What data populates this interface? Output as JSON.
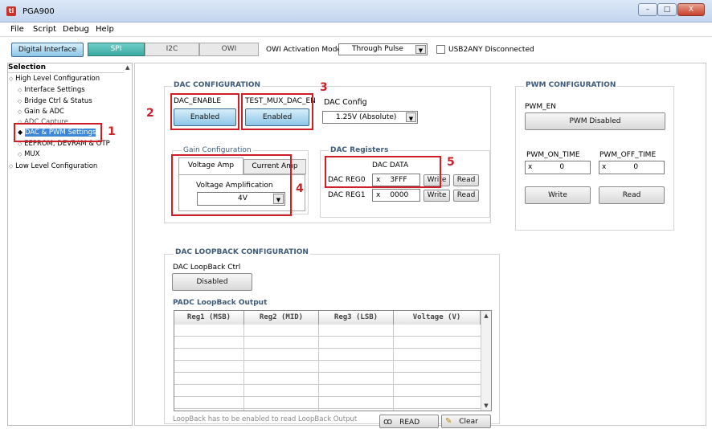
{
  "window": {
    "title": "PGA900",
    "app_icon": "ti-logo-icon",
    "controls": {
      "minimize": "–",
      "maximize": "□",
      "close": "X"
    }
  },
  "menu": [
    "File",
    "Script",
    "Debug",
    "Help"
  ],
  "toolbar": {
    "digital_interface": "Digital Interface",
    "tabs": [
      "SPI",
      "I2C",
      "OWI"
    ],
    "selected_tab": "SPI",
    "owi_mode_label": "OWI Activation Mode",
    "owi_mode_value": "Through Pulse",
    "usb_label": "USB2ANY Disconnected"
  },
  "sidebar": {
    "header": "Selection",
    "items": [
      {
        "label": "High Level Configuration",
        "level": 0
      },
      {
        "label": "Interface Settings",
        "level": 1
      },
      {
        "label": "Bridge Ctrl & Status",
        "level": 1
      },
      {
        "label": "Gain & ADC",
        "level": 1
      },
      {
        "label": "ADC Capture",
        "level": 1
      },
      {
        "label": "DAC & PWM Settings",
        "level": 1,
        "selected": true
      },
      {
        "label": "EEPROM, DEVRAM & OTP",
        "level": 1
      },
      {
        "label": "MUX",
        "level": 1
      },
      {
        "label": "Low Level Configuration",
        "level": 0
      }
    ]
  },
  "dac_config": {
    "title": "DAC CONFIGURATION",
    "dac_enable_label": "DAC_ENABLE",
    "dac_enable_btn": "Enabled",
    "test_mux_label": "TEST_MUX_DAC_EN",
    "test_mux_btn": "Enabled",
    "dac_config_label": "DAC Config",
    "dac_config_value": "1.25V (Absolute)"
  },
  "gain": {
    "title": "Gain Configuration",
    "tabs": [
      "Voltage Amp",
      "Current Amp"
    ],
    "amp_label": "Voltage Amplification",
    "amp_value": "4V"
  },
  "dac_registers": {
    "title": "DAC Registers",
    "data_label": "DAC DATA",
    "rows": [
      {
        "label": "DAC REG0",
        "prefix": "x",
        "value": "3FFF",
        "write": "Write",
        "read": "Read"
      },
      {
        "label": "DAC REG1",
        "prefix": "x",
        "value": "0000",
        "write": "Write",
        "read": "Read"
      }
    ]
  },
  "pwm": {
    "title": "PWM CONFIGURATION",
    "en_label": "PWM_EN",
    "en_btn": "PWM Disabled",
    "on_label": "PWM_ON_TIME",
    "on_prefix": "x",
    "on_value": "0",
    "off_label": "PWM_OFF_TIME",
    "off_prefix": "x",
    "off_value": "0",
    "write": "Write",
    "read": "Read"
  },
  "loopback": {
    "title": "DAC LOOPBACK CONFIGURATION",
    "ctrl_label": "DAC LoopBack Ctrl",
    "ctrl_btn": "Disabled",
    "output_label": "PADC LoopBack Output",
    "columns": [
      "Reg1 (MSB)",
      "Reg2 (MID)",
      "Reg3 (LSB)",
      "Voltage (V)"
    ],
    "row_count": 7,
    "note": "LoopBack has to be enabled to read LoopBack Output",
    "read_btn": "READ",
    "clear_btn": "Clear"
  },
  "annotations": [
    "1",
    "2",
    "3",
    "4",
    "5"
  ],
  "colors": {
    "annotation_red": "#cf1e26",
    "selected_blue": "#3e87d8",
    "tab_teal": "#3aa9a0"
  }
}
